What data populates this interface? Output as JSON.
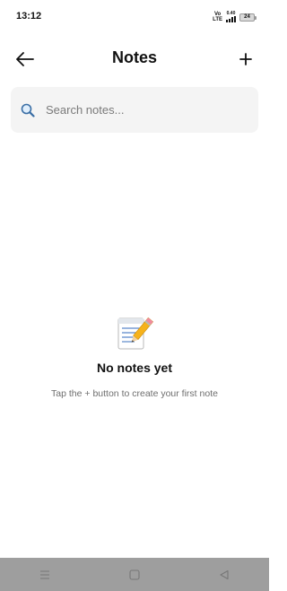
{
  "status_bar": {
    "time": "13:12",
    "volte_top": "Vo",
    "volte_bottom": "LTE",
    "net_speed": "0.40",
    "battery": "24"
  },
  "header": {
    "title": "Notes",
    "back_icon": "arrow-left-icon",
    "add_icon": "plus-icon"
  },
  "search": {
    "placeholder": "Search notes...",
    "value": "",
    "icon": "magnifier-icon"
  },
  "empty_state": {
    "icon": "memo-pencil-icon",
    "title": "No notes yet",
    "subtitle": "Tap the + button to create your first note"
  },
  "nav_bar": {
    "background": "#9e9e9e",
    "buttons": [
      "menu-icon",
      "home-square-icon",
      "back-triangle-icon"
    ]
  }
}
